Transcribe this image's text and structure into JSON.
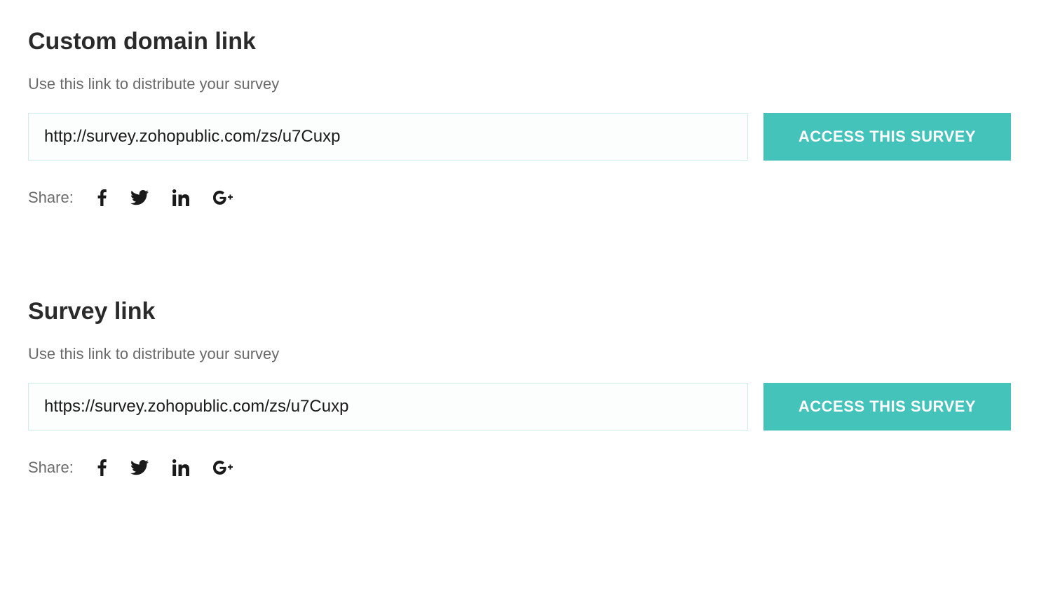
{
  "sections": [
    {
      "title": "Custom domain link",
      "subtitle": "Use this link to distribute your survey",
      "url": "http://survey.zohopublic.com/zs/u7Cuxp",
      "button_label": "ACCESS THIS SURVEY",
      "share_label": "Share:"
    },
    {
      "title": "Survey link",
      "subtitle": "Use this link to distribute your survey",
      "url": "https://survey.zohopublic.com/zs/u7Cuxp",
      "button_label": "ACCESS THIS SURVEY",
      "share_label": "Share:"
    }
  ]
}
